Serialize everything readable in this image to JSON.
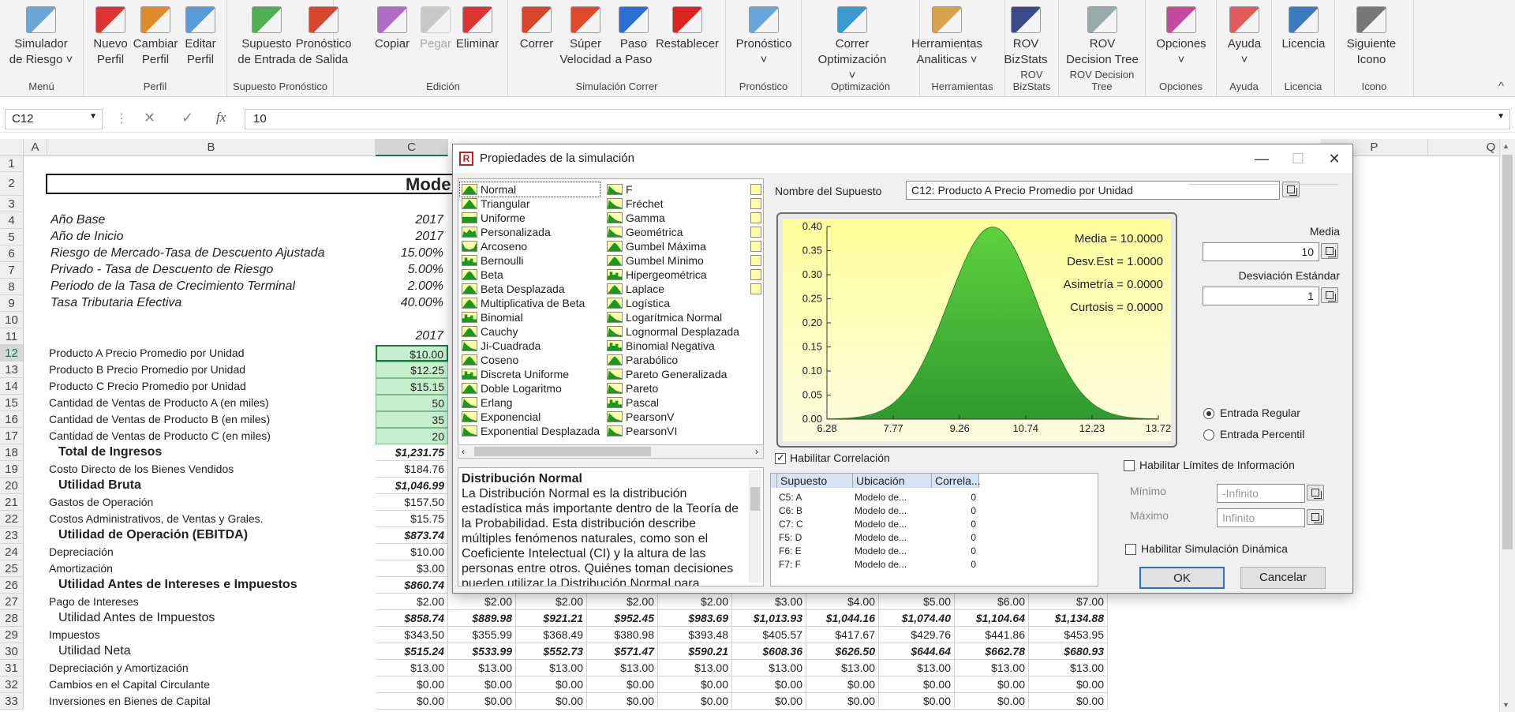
{
  "ribbon": {
    "groups": [
      {
        "name": "Menú",
        "buttons": [
          {
            "label": "Simulador\nde Riesgo ˅",
            "icon": "risk-simulator-icon"
          }
        ]
      },
      {
        "name": "Perfil",
        "buttons": [
          {
            "label": "Nuevo\nPerfil",
            "icon": "new-profile-icon"
          },
          {
            "label": "Cambiar\nPerfil",
            "icon": "change-profile-icon"
          },
          {
            "label": "Editar\nPerfil",
            "icon": "edit-profile-icon"
          }
        ]
      },
      {
        "name": "Supuesto   Pronóstico",
        "buttons": [
          {
            "label": "Supuesto\nde Entrada",
            "icon": "input-assumption-icon"
          },
          {
            "label": "Pronóstico\nde Salida",
            "icon": "output-forecast-icon"
          }
        ]
      },
      {
        "name": "Edición",
        "buttons": [
          {
            "label": "Copiar",
            "icon": "copy-icon"
          },
          {
            "label": "Pegar",
            "icon": "paste-icon",
            "disabled": true
          },
          {
            "label": "Eliminar",
            "icon": "delete-icon"
          }
        ]
      },
      {
        "name": "Simulación Correr",
        "buttons": [
          {
            "label": "Correr",
            "icon": "run-icon"
          },
          {
            "label": "Súper\nVelocidad",
            "icon": "super-speed-icon"
          },
          {
            "label": "Paso\na Paso",
            "icon": "step-icon"
          },
          {
            "label": "Restablecer",
            "icon": "reset-icon"
          }
        ]
      },
      {
        "name": "Pronóstico",
        "buttons": [
          {
            "label": "Pronóstico\n˅",
            "icon": "forecast-icon"
          }
        ]
      },
      {
        "name": "Optimización",
        "buttons": [
          {
            "label": "Correr\nOptimización ˅",
            "icon": "optimization-icon"
          }
        ]
      },
      {
        "name": "Herramientas",
        "buttons": [
          {
            "label": "Herramientas\nAnaliticas ˅",
            "icon": "analytical-tools-icon"
          }
        ]
      },
      {
        "name": "ROV BizStats",
        "buttons": [
          {
            "label": "ROV\nBizStats",
            "icon": "bizstats-icon"
          }
        ]
      },
      {
        "name": "ROV Decision Tree",
        "buttons": [
          {
            "label": "ROV\nDecision Tree",
            "icon": "decision-tree-icon"
          }
        ]
      },
      {
        "name": "Opciones",
        "buttons": [
          {
            "label": "Opciones\n˅",
            "icon": "options-icon"
          }
        ]
      },
      {
        "name": "Ayuda",
        "buttons": [
          {
            "label": "Ayuda\n˅",
            "icon": "help-icon"
          }
        ]
      },
      {
        "name": "Licencia",
        "buttons": [
          {
            "label": "Licencia",
            "icon": "license-icon"
          }
        ]
      },
      {
        "name": "Icono",
        "buttons": [
          {
            "label": "Siguiente\nIcono",
            "icon": "next-icon-icon"
          }
        ]
      }
    ],
    "collapse": "^"
  },
  "formula_bar": {
    "name_box": "C12",
    "cancel": "✕",
    "enter": "✓",
    "fx": "fx",
    "value": "10"
  },
  "columns": [
    "A",
    "B",
    "C",
    "P",
    "Q"
  ],
  "rows": [
    "1",
    "2",
    "3",
    "4",
    "5",
    "6",
    "7",
    "8",
    "9",
    "10",
    "11",
    "12",
    "13",
    "14",
    "15",
    "16",
    "17",
    "18",
    "19",
    "20",
    "21",
    "22",
    "23",
    "24",
    "25",
    "26",
    "27",
    "28",
    "29",
    "30",
    "31",
    "32",
    "33"
  ],
  "sheet": {
    "title": "Mode",
    "params": [
      {
        "label": "Año Base",
        "value": "2017"
      },
      {
        "label": "Año de Inicio",
        "value": "2017"
      },
      {
        "label": "Riesgo de Mercado-Tasa de Descuento Ajustada",
        "value": "15.00%"
      },
      {
        "label": "Privado - Tasa de Descuento de Riesgo",
        "value": "5.00%"
      },
      {
        "label": "Periodo de la Tasa de Crecimiento Terminal",
        "value": "2.00%"
      },
      {
        "label": "Tasa Tributaria Efectiva",
        "value": "40.00%"
      }
    ],
    "year": "2017",
    "lines": [
      {
        "label": "Producto A Precio Promedio por Unidad",
        "c": "$10.00"
      },
      {
        "label": "Producto B Precio Promedio por Unidad",
        "c": "$12.25"
      },
      {
        "label": "Producto C Precio Promedio por Unidad",
        "c": "$15.15"
      },
      {
        "label": "Cantidad de Ventas de Producto A (en miles)",
        "c": "50"
      },
      {
        "label": "Cantidad de Ventas de Producto B (en miles)",
        "c": "35"
      },
      {
        "label": "Cantidad de Ventas de Producto C (en miles)",
        "c": "20"
      },
      {
        "label": "Total de Ingresos",
        "c": "$1,231.75",
        "bold": true
      },
      {
        "label": "Costo Directo de los Bienes Vendidos",
        "c": "$184.76"
      },
      {
        "label": "Utilidad Bruta",
        "c": "$1,046.99",
        "bold": true
      },
      {
        "label": "Gastos de Operación",
        "c": "$157.50"
      },
      {
        "label": "Costos Administrativos, de Ventas y Grales.",
        "c": "$15.75"
      },
      {
        "label": "Utilidad de Operación (EBITDA)",
        "c": "$873.74",
        "bold": true
      },
      {
        "label": "Depreciación",
        "c": "$10.00"
      },
      {
        "label": "Amortización",
        "c": "$3.00"
      },
      {
        "label": "Utilidad Antes de Intereses e Impuestos",
        "c": "$860.74",
        "bold": true
      },
      {
        "label": "Pago de Intereses",
        "c": "$2.00",
        "more": [
          "$2.00",
          "$2.00",
          "$2.00",
          "$2.00",
          "$3.00",
          "$4.00",
          "$5.00",
          "$6.00",
          "$7.00"
        ]
      },
      {
        "label": "Utilidad Antes de Impuestos",
        "c": "$858.74",
        "bold": true,
        "more": [
          "$889.98",
          "$921.21",
          "$952.45",
          "$983.69",
          "$1,013.93",
          "$1,044.16",
          "$1,074.40",
          "$1,104.64",
          "$1,134.88"
        ]
      },
      {
        "label": "Impuestos",
        "c": "$343.50",
        "more": [
          "$355.99",
          "$368.49",
          "$380.98",
          "$393.48",
          "$405.57",
          "$417.67",
          "$429.76",
          "$441.86",
          "$453.95"
        ]
      },
      {
        "label": "Utilidad Neta",
        "c": "$515.24",
        "bold": true,
        "more": [
          "$533.99",
          "$552.73",
          "$571.47",
          "$590.21",
          "$608.36",
          "$626.50",
          "$644.64",
          "$662.78",
          "$680.93"
        ]
      },
      {
        "label": "Depreciación y Amortización",
        "c": "$13.00",
        "more": [
          "$13.00",
          "$13.00",
          "$13.00",
          "$13.00",
          "$13.00",
          "$13.00",
          "$13.00",
          "$13.00",
          "$13.00"
        ]
      },
      {
        "label": "Cambios en el Capital Circulante",
        "c": "$0.00",
        "more": [
          "$0.00",
          "$0.00",
          "$0.00",
          "$0.00",
          "$0.00",
          "$0.00",
          "$0.00",
          "$0.00",
          "$0.00"
        ]
      },
      {
        "label": "Inversiones en Bienes de Capital",
        "c": "$0.00",
        "more": [
          "$0.00",
          "$0.00",
          "$0.00",
          "$0.00",
          "$0.00",
          "$0.00",
          "$0.00",
          "$0.00",
          "$0.00"
        ]
      }
    ]
  },
  "dialog": {
    "title": "Propiedades de la simulación",
    "controls": {
      "minimize": "—",
      "maximize": "☐",
      "close": "✕"
    },
    "dist_col1": [
      "Normal",
      "Triangular",
      "Uniforme",
      "Personalizada",
      "Arcoseno",
      "Bernoulli",
      "Beta",
      "Beta Desplazada",
      "Multiplicativa de Beta",
      "Binomial",
      "Cauchy",
      "Ji-Cuadrada",
      "Coseno",
      "Discreta Uniforme",
      "Doble Logaritmo",
      "Erlang",
      "Exponencial",
      "Exponential Desplazada"
    ],
    "dist_col2": [
      "F",
      "Fréchet",
      "Gamma",
      "Geométrica",
      "Gumbel Máxima",
      "Gumbel Mínimo",
      "Hipergeométrica",
      "Laplace",
      "Logística",
      "Logarítmica Normal",
      "Lognormal Desplazada",
      "Binomial Negativa",
      "Parabólico",
      "Pareto Generalizada",
      "Pareto",
      "Pascal",
      "PearsonV",
      "PearsonVI"
    ],
    "description_title": "Distribución Normal",
    "description": "La Distribución Normal es la distribución estadística más importante dentro de la Teoría de la Probabilidad. Esta distribución describe múltiples fenómenos naturales, como son el Coeficiente Intelectual (CI) y la altura de las personas entre otros. Quiénes toman decisiones pueden utilizar la Distribución Normal para",
    "assumption_label": "Nombre del Supuesto",
    "assumption_name": "C12: Producto A Precio Promedio por Unidad",
    "stats": [
      "Media = 10.0000",
      "Desv.Est = 1.0000",
      "Asimetría = 0.0000",
      "Curtosis = 0.0000"
    ],
    "mean_label": "Media",
    "mean_value": "10",
    "sd_label": "Desviación Estándar",
    "sd_value": "1",
    "radio_regular": "Entrada Regular",
    "radio_percentile": "Entrada Percentil",
    "enable_correlation": "Habilitar Correlación",
    "corr_headers": [
      "Supuesto",
      "Ubicación",
      "Correla..."
    ],
    "corr_rows": [
      [
        "C5: A",
        "Modelo de...",
        "0"
      ],
      [
        "C6: B",
        "Modelo de...",
        "0"
      ],
      [
        "C7: C",
        "Modelo de...",
        "0"
      ],
      [
        "F5: D",
        "Modelo de...",
        "0"
      ],
      [
        "F6: E",
        "Modelo de...",
        "0"
      ],
      [
        "F7: F",
        "Modelo de...",
        "0"
      ]
    ],
    "enable_limits": "Habilitar Límites de Información",
    "min_label": "Mínimo",
    "min_placeholder": "-Infinito",
    "max_label": "Máximo",
    "max_placeholder": "Infinito",
    "enable_dynamic": "Habilitar Simulación Dinámica",
    "ok": "OK",
    "cancel": "Cancelar",
    "accent": "#3da63d"
  },
  "chart_data": {
    "type": "area",
    "title": "",
    "xlabel": "",
    "ylabel": "",
    "distribution": "normal",
    "mean": 10,
    "sd": 1,
    "xticks": [
      "6.28",
      "7.77",
      "9.26",
      "10.74",
      "12.23",
      "13.72"
    ],
    "yticks": [
      "0.00",
      "0.05",
      "0.10",
      "0.15",
      "0.20",
      "0.25",
      "0.30",
      "0.35",
      "0.40"
    ],
    "xlim": [
      6.28,
      13.72
    ],
    "ylim": [
      0,
      0.4
    ]
  }
}
